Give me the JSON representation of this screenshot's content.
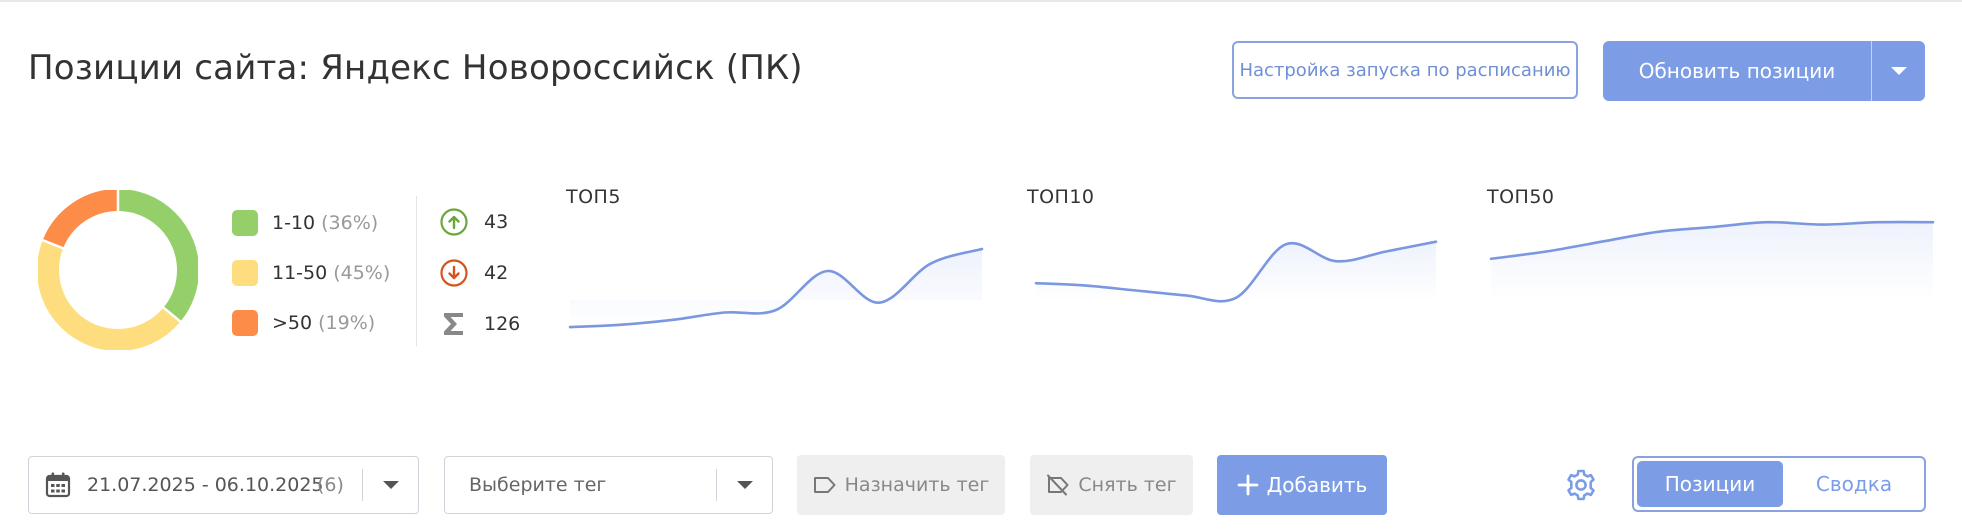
{
  "header": {
    "title": "Позиции сайта: Яндекс Новороссийск (ПК)",
    "schedule_button": "Настройка запуска по расписанию",
    "update_button": "Обновить позиции",
    "update_dropdown_icon": "chevron-down-icon"
  },
  "distribution": {
    "segments": [
      {
        "label": "1-10",
        "percent_text": "(36%)",
        "percent": 36,
        "color": "#95cf6a"
      },
      {
        "label": "11-50",
        "percent_text": "(45%)",
        "percent": 45,
        "color": "#fddd7d"
      },
      {
        "label": ">50",
        "percent_text": "(19%)",
        "percent": 19,
        "color": "#fd8c48"
      }
    ]
  },
  "stats": {
    "up": {
      "icon": "arrow-up-circle-icon",
      "value": "43",
      "color": "#6ba63b"
    },
    "down": {
      "icon": "arrow-down-circle-icon",
      "value": "42",
      "color": "#d4541c"
    },
    "total": {
      "icon": "sigma-icon",
      "value": "126",
      "color": "#888888"
    }
  },
  "chart_data": [
    {
      "type": "area",
      "title": "ТОП5",
      "series": [
        {
          "values": [
            2,
            3,
            5,
            8,
            9,
            25,
            12,
            28,
            34
          ]
        }
      ]
    },
    {
      "type": "area",
      "title": "ТОП10",
      "series": [
        {
          "values": [
            20,
            19,
            17,
            15,
            14,
            36,
            29,
            33,
            37
          ]
        }
      ]
    },
    {
      "type": "area",
      "title": "ТОП50",
      "series": [
        {
          "values": [
            30,
            33,
            37,
            41,
            43,
            45,
            44,
            45,
            45
          ]
        }
      ]
    }
  ],
  "toolbar": {
    "date_range": "21.07.2025 - 06.10.2025",
    "date_count": "(6)",
    "calendar_icon": "calendar-icon",
    "tag_placeholder": "Выберите тег",
    "assign_tag": "Назначить тег",
    "remove_tag": "Снять тег",
    "add": "Добавить",
    "settings_icon": "gear-icon",
    "view_positions": "Позиции",
    "view_summary": "Сводка"
  },
  "colors": {
    "accent": "#7c9de6",
    "accent_border": "#8aa3e0",
    "chart_line": "#7a97e0",
    "chart_fill": "#eef2fc"
  }
}
